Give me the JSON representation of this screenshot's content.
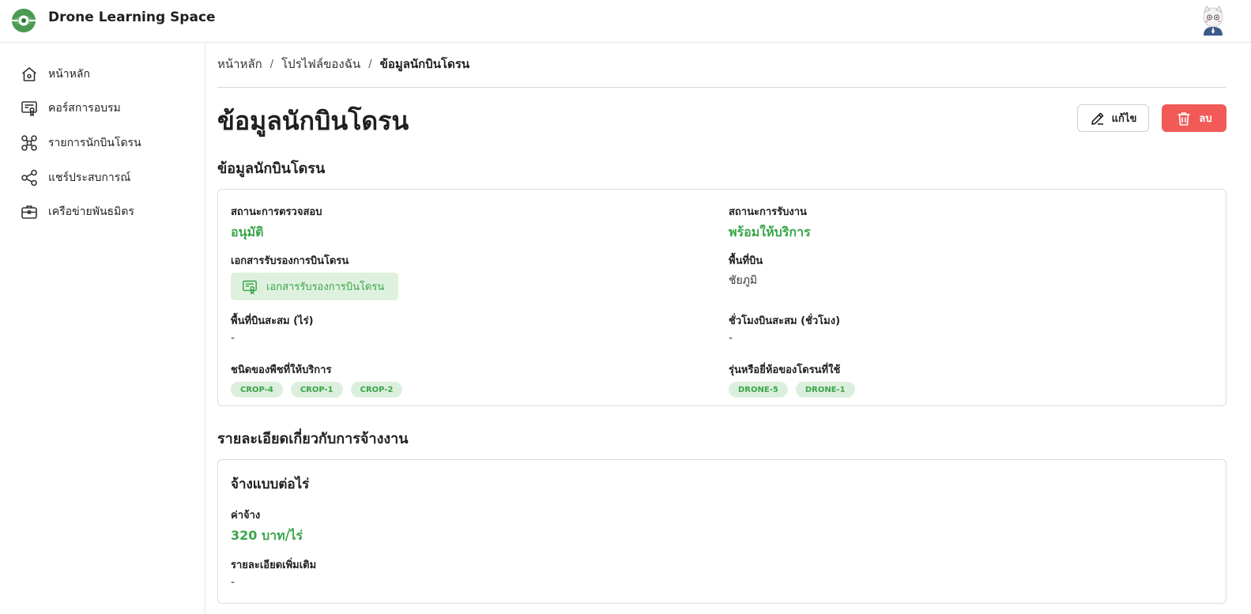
{
  "app": {
    "title": "Drone Learning Space"
  },
  "icons": {
    "logo": "drone-eye-logo-icon",
    "home": "home-icon",
    "courses": "certificate-icon",
    "pilots": "drone-icon",
    "share": "share-icon",
    "network": "briefcase-icon",
    "edit": "pencil-icon",
    "delete": "trash-icon",
    "document": "certificate-icon"
  },
  "colors": {
    "brand_green": "#3aa54a",
    "chip_bg": "#dcefdc",
    "danger": "#f15a57"
  },
  "sidebar": {
    "items": [
      {
        "label": "หน้าหลัก"
      },
      {
        "label": "คอร์สการอบรม"
      },
      {
        "label": "รายการนักบินโดรน"
      },
      {
        "label": "แชร์ประสบการณ์"
      },
      {
        "label": "เครือข่ายพันธมิตร"
      }
    ]
  },
  "breadcrumb": {
    "home": "หน้าหลัก",
    "profile": "โปรไฟล์ของฉัน",
    "current": "ข้อมูลนักบินโดรน",
    "separator": "/"
  },
  "page": {
    "title": "ข้อมูลนักบินโดรน"
  },
  "actions": {
    "edit_label": "แก้ไข",
    "delete_label": "ลบ"
  },
  "pilot_info": {
    "section_title": "ข้อมูลนักบินโดรน",
    "verification_status_label": "สถานะการตรวจสอบ",
    "verification_status_value": "อนุมัติ",
    "job_status_label": "สถานะการรับงาน",
    "job_status_value": "พร้อมให้บริการ",
    "certificate_label": "เอกสารรับรองการบินโดรน",
    "certificate_button": "เอกสารรับรองการบินโดรน",
    "area_label": "พื้นที่บิน",
    "area_value": "ชัยภูมิ",
    "accum_area_label": "พื้นที่บินสะสม (ไร่)",
    "accum_area_value": "-",
    "accum_hours_label": "ชั่วโมงบินสะสม (ชั่วโมง)",
    "accum_hours_value": "-",
    "crops_label": "ชนิดของพืชที่ให้บริการ",
    "crops": [
      "CROP-4",
      "CROP-1",
      "CROP-2"
    ],
    "drones_label": "รุ่นหรือยี่ห้อของโดรนที่ใช้",
    "drones": [
      "DRONE-5",
      "DRONE-1"
    ]
  },
  "employment": {
    "section_title": "รายละเอียดเกี่ยวกับการจ้างงาน",
    "card_title": "จ้างแบบต่อไร่",
    "fee_label": "ค่าจ้าง",
    "fee_value": "320 บาท/ไร่",
    "details_label": "รายละเอียดเพิ่มเติม",
    "details_value": "-"
  }
}
